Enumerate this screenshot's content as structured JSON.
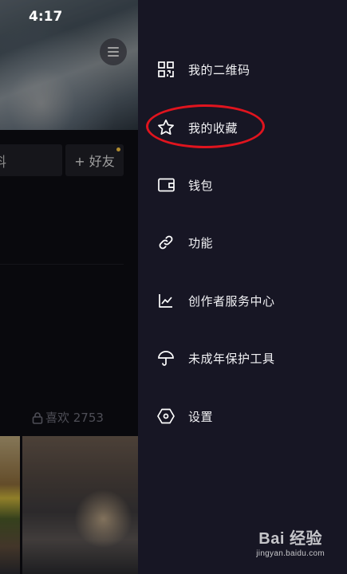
{
  "status_bar": {
    "time": "4:17"
  },
  "background": {
    "edit_button_label": "料",
    "add_friend_label": "+ 好友",
    "likes_label": "喜欢 2753"
  },
  "drawer": {
    "items": [
      {
        "label": "我的二维码",
        "icon": "qr-code-icon"
      },
      {
        "label": "我的收藏",
        "icon": "star-icon"
      },
      {
        "label": "钱包",
        "icon": "wallet-icon"
      },
      {
        "label": "功能",
        "icon": "link-icon"
      },
      {
        "label": "创作者服务中心",
        "icon": "chart-icon"
      },
      {
        "label": "未成年保护工具",
        "icon": "umbrella-icon"
      },
      {
        "label": "设置",
        "icon": "settings-hexagon-icon"
      }
    ]
  },
  "annotation": {
    "highlight_color": "#e0141e"
  },
  "watermark": {
    "brand": "Bai 经验",
    "domain": "jingyan.baidu.com"
  }
}
